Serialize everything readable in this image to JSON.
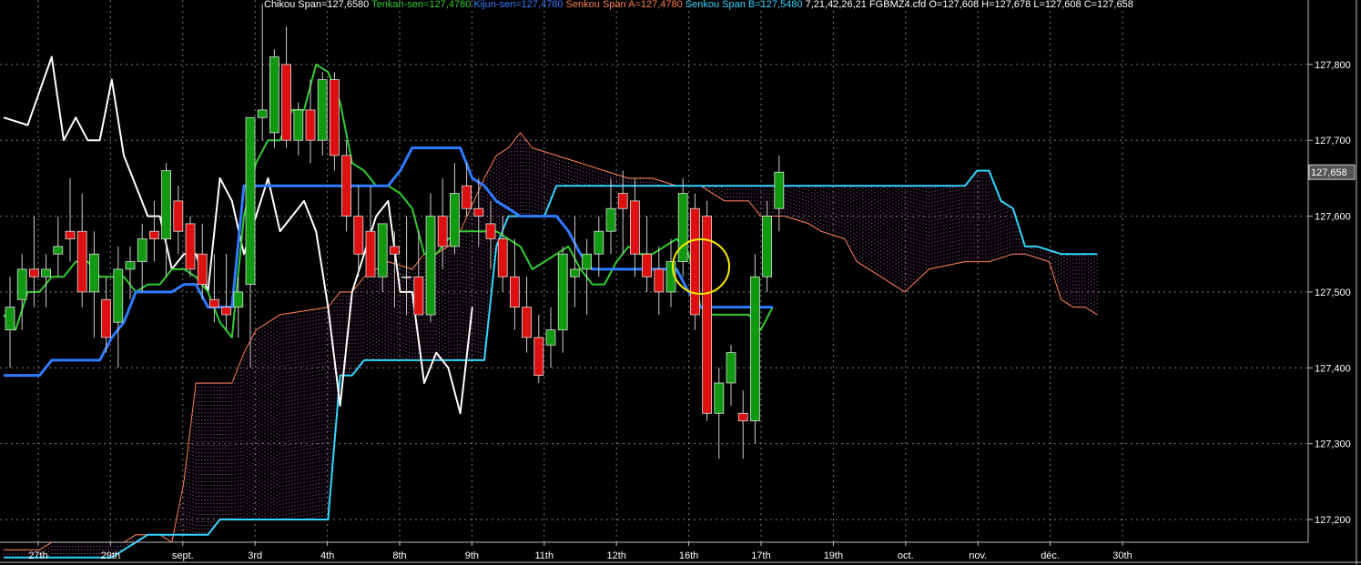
{
  "header": {
    "items": [
      {
        "text": "Chikou Span=127,6580",
        "color": "#ffffff"
      },
      {
        "text": "Tenkan-sen=127,4780",
        "color": "#33cc33"
      },
      {
        "text": "Kijun-sen=127,4780",
        "color": "#3a7bff"
      },
      {
        "text": "Senkou Span A=127,4780",
        "color": "#ff7f50"
      },
      {
        "text": "Senkou Span B=127,5480",
        "color": "#33d6ff"
      },
      {
        "text": "7,21,42,26,21",
        "color": "#ffffff"
      },
      {
        "text": "FGBMZ4.cfd O=127,608 H=127,678 L=127,608 C=127,658",
        "color": "#ffffff"
      }
    ]
  },
  "colors": {
    "background": "#000000",
    "grid": "#7a7a7a",
    "bull": "#119a11",
    "bear": "#dd1111",
    "wick": "#cccccc",
    "chikou": "#ffffff",
    "tenkan": "#33cc33",
    "kijun": "#2f7bff",
    "spanA": "#ff7f50",
    "spanB": "#33d6ff",
    "cloud": "#d36bd3",
    "highlight": "#ffee00"
  },
  "chart_data": {
    "type": "candlestick",
    "ylim": [
      127.17,
      127.885
    ],
    "x_ticks": [
      "27th",
      "29th",
      "sept.",
      "3rd",
      "4th",
      "8th",
      "9th",
      "11th",
      "12th",
      "16th",
      "17th",
      "19th",
      "oct.",
      "nov.",
      "déc.",
      "30th"
    ],
    "y_ticks": [
      "127,200",
      "127,300",
      "127,400",
      "127,500",
      "127,600",
      "127,700",
      "127,800"
    ],
    "y_tick_values": [
      127.2,
      127.3,
      127.4,
      127.5,
      127.6,
      127.7,
      127.8
    ],
    "last_price_label": "127,658",
    "last_price": 127.658,
    "candles": [
      {
        "o": 127.45,
        "h": 127.52,
        "l": 127.4,
        "c": 127.48
      },
      {
        "o": 127.49,
        "h": 127.55,
        "l": 127.45,
        "c": 127.53
      },
      {
        "o": 127.53,
        "h": 127.6,
        "l": 127.48,
        "c": 127.52
      },
      {
        "o": 127.52,
        "h": 127.55,
        "l": 127.48,
        "c": 127.53
      },
      {
        "o": 127.55,
        "h": 127.6,
        "l": 127.52,
        "c": 127.56
      },
      {
        "o": 127.58,
        "h": 127.65,
        "l": 127.54,
        "c": 127.57
      },
      {
        "o": 127.58,
        "h": 127.63,
        "l": 127.48,
        "c": 127.5
      },
      {
        "o": 127.5,
        "h": 127.58,
        "l": 127.44,
        "c": 127.55
      },
      {
        "o": 127.49,
        "h": 127.52,
        "l": 127.42,
        "c": 127.44
      },
      {
        "o": 127.46,
        "h": 127.56,
        "l": 127.4,
        "c": 127.53
      },
      {
        "o": 127.53,
        "h": 127.56,
        "l": 127.49,
        "c": 127.54
      },
      {
        "o": 127.54,
        "h": 127.59,
        "l": 127.5,
        "c": 127.57
      },
      {
        "o": 127.58,
        "h": 127.62,
        "l": 127.54,
        "c": 127.57
      },
      {
        "o": 127.57,
        "h": 127.67,
        "l": 127.52,
        "c": 127.66
      },
      {
        "o": 127.62,
        "h": 127.64,
        "l": 127.55,
        "c": 127.58
      },
      {
        "o": 127.59,
        "h": 127.6,
        "l": 127.52,
        "c": 127.53
      },
      {
        "o": 127.55,
        "h": 127.59,
        "l": 127.49,
        "c": 127.51
      },
      {
        "o": 127.49,
        "h": 127.55,
        "l": 127.46,
        "c": 127.48
      },
      {
        "o": 127.48,
        "h": 127.55,
        "l": 127.45,
        "c": 127.47
      },
      {
        "o": 127.48,
        "h": 127.52,
        "l": 127.44,
        "c": 127.5
      },
      {
        "o": 127.51,
        "h": 127.7,
        "l": 127.4,
        "c": 127.73
      },
      {
        "o": 127.73,
        "h": 127.88,
        "l": 127.7,
        "c": 127.74
      },
      {
        "o": 127.71,
        "h": 127.82,
        "l": 127.69,
        "c": 127.81
      },
      {
        "o": 127.8,
        "h": 127.85,
        "l": 127.69,
        "c": 127.7
      },
      {
        "o": 127.7,
        "h": 127.75,
        "l": 127.68,
        "c": 127.74
      },
      {
        "o": 127.74,
        "h": 127.78,
        "l": 127.67,
        "c": 127.7
      },
      {
        "o": 127.7,
        "h": 127.79,
        "l": 127.68,
        "c": 127.78
      },
      {
        "o": 127.78,
        "h": 127.79,
        "l": 127.66,
        "c": 127.68
      },
      {
        "o": 127.68,
        "h": 127.7,
        "l": 127.58,
        "c": 127.6
      },
      {
        "o": 127.6,
        "h": 127.64,
        "l": 127.52,
        "c": 127.55
      },
      {
        "o": 127.58,
        "h": 127.64,
        "l": 127.52,
        "c": 127.52
      },
      {
        "o": 127.52,
        "h": 127.58,
        "l": 127.5,
        "c": 127.59
      },
      {
        "o": 127.56,
        "h": 127.58,
        "l": 127.48,
        "c": 127.55
      },
      {
        "o": 127.52,
        "h": 127.6,
        "l": 127.47,
        "c": 127.52
      },
      {
        "o": 127.52,
        "h": 127.58,
        "l": 127.47,
        "c": 127.47
      },
      {
        "o": 127.47,
        "h": 127.63,
        "l": 127.46,
        "c": 127.6
      },
      {
        "o": 127.6,
        "h": 127.65,
        "l": 127.53,
        "c": 127.56
      },
      {
        "o": 127.56,
        "h": 127.67,
        "l": 127.55,
        "c": 127.63
      },
      {
        "o": 127.64,
        "h": 127.67,
        "l": 127.6,
        "c": 127.61
      },
      {
        "o": 127.61,
        "h": 127.65,
        "l": 127.56,
        "c": 127.6
      },
      {
        "o": 127.59,
        "h": 127.62,
        "l": 127.53,
        "c": 127.57
      },
      {
        "o": 127.57,
        "h": 127.6,
        "l": 127.5,
        "c": 127.52
      },
      {
        "o": 127.52,
        "h": 127.57,
        "l": 127.45,
        "c": 127.48
      },
      {
        "o": 127.48,
        "h": 127.52,
        "l": 127.42,
        "c": 127.44
      },
      {
        "o": 127.44,
        "h": 127.47,
        "l": 127.38,
        "c": 127.39
      },
      {
        "o": 127.43,
        "h": 127.48,
        "l": 127.4,
        "c": 127.45
      },
      {
        "o": 127.45,
        "h": 127.56,
        "l": 127.42,
        "c": 127.55
      },
      {
        "o": 127.52,
        "h": 127.6,
        "l": 127.48,
        "c": 127.53
      },
      {
        "o": 127.53,
        "h": 127.57,
        "l": 127.47,
        "c": 127.55
      },
      {
        "o": 127.55,
        "h": 127.6,
        "l": 127.52,
        "c": 127.58
      },
      {
        "o": 127.58,
        "h": 127.65,
        "l": 127.55,
        "c": 127.61
      },
      {
        "o": 127.63,
        "h": 127.66,
        "l": 127.55,
        "c": 127.61
      },
      {
        "o": 127.62,
        "h": 127.65,
        "l": 127.52,
        "c": 127.55
      },
      {
        "o": 127.55,
        "h": 127.6,
        "l": 127.5,
        "c": 127.52
      },
      {
        "o": 127.53,
        "h": 127.56,
        "l": 127.47,
        "c": 127.5
      },
      {
        "o": 127.5,
        "h": 127.57,
        "l": 127.48,
        "c": 127.54
      },
      {
        "o": 127.54,
        "h": 127.65,
        "l": 127.52,
        "c": 127.63
      },
      {
        "o": 127.61,
        "h": 127.63,
        "l": 127.45,
        "c": 127.47
      },
      {
        "o": 127.6,
        "h": 127.62,
        "l": 127.33,
        "c": 127.34
      },
      {
        "o": 127.34,
        "h": 127.4,
        "l": 127.28,
        "c": 127.38
      },
      {
        "o": 127.38,
        "h": 127.43,
        "l": 127.35,
        "c": 127.42
      },
      {
        "o": 127.34,
        "h": 127.37,
        "l": 127.28,
        "c": 127.33
      },
      {
        "o": 127.33,
        "h": 127.55,
        "l": 127.3,
        "c": 127.52
      },
      {
        "o": 127.52,
        "h": 127.62,
        "l": 127.5,
        "c": 127.6
      },
      {
        "o": 127.61,
        "h": 127.68,
        "l": 127.58,
        "c": 127.658
      }
    ],
    "series": [
      {
        "name": "Chikou Span",
        "x": [
          0,
          2,
          4,
          5,
          6,
          7,
          8,
          9,
          10,
          12,
          13,
          14,
          15,
          16,
          17,
          18,
          19,
          20,
          21,
          22,
          23,
          24,
          25,
          26,
          27,
          28,
          29,
          30,
          31,
          32,
          33,
          34,
          35,
          36,
          37,
          38,
          39
        ],
        "values": [
          127.73,
          127.72,
          127.81,
          127.7,
          127.73,
          127.7,
          127.7,
          127.78,
          127.68,
          127.6,
          127.6,
          127.53,
          127.55,
          127.55,
          127.5,
          127.65,
          127.62,
          127.55,
          127.6,
          127.65,
          127.58,
          127.6,
          127.62,
          127.58,
          127.48,
          127.35,
          127.5,
          127.55,
          127.6,
          127.62,
          127.5,
          127.5,
          127.38,
          127.42,
          127.4,
          127.34,
          127.48
        ]
      },
      {
        "name": "Tenkan-sen",
        "x": [
          0,
          1,
          2,
          3,
          4,
          5,
          6,
          7,
          8,
          9,
          10,
          11,
          12,
          13,
          14,
          15,
          16,
          17,
          18,
          19,
          20,
          21,
          22,
          23,
          24,
          25,
          26,
          27,
          28,
          29,
          30,
          31,
          32,
          33,
          34,
          35,
          36,
          37,
          38,
          39,
          40,
          41,
          42,
          43,
          44,
          45,
          46,
          47,
          48,
          49,
          50,
          51,
          52,
          53,
          54,
          55,
          56,
          57,
          58,
          59,
          60,
          61,
          62,
          63,
          64
        ],
        "values": [
          127.47,
          127.45,
          127.5,
          127.5,
          127.52,
          127.52,
          127.54,
          127.54,
          127.52,
          127.52,
          127.52,
          127.5,
          127.51,
          127.51,
          127.53,
          127.53,
          127.52,
          127.5,
          127.46,
          127.44,
          127.6,
          127.67,
          127.7,
          127.7,
          127.74,
          127.74,
          127.8,
          127.79,
          127.75,
          127.67,
          127.66,
          127.64,
          127.64,
          127.63,
          127.61,
          127.55,
          127.55,
          127.57,
          127.58,
          127.58,
          127.58,
          127.58,
          127.57,
          127.56,
          127.53,
          127.54,
          127.55,
          127.56,
          127.53,
          127.51,
          127.51,
          127.54,
          127.56,
          127.55,
          127.55,
          127.56,
          127.57,
          127.55,
          127.48,
          127.47,
          127.47,
          127.47,
          127.47,
          127.45,
          127.48
        ]
      },
      {
        "name": "Kijun-sen",
        "x": [
          0,
          1,
          2,
          3,
          4,
          5,
          6,
          7,
          8,
          9,
          10,
          11,
          12,
          13,
          14,
          15,
          16,
          17,
          18,
          19,
          20,
          21,
          22,
          23,
          24,
          25,
          26,
          27,
          28,
          29,
          30,
          31,
          32,
          33,
          34,
          35,
          36,
          37,
          38,
          39,
          40,
          41,
          42,
          43,
          44,
          45,
          46,
          47,
          48,
          49,
          50,
          51,
          52,
          53,
          54,
          55,
          56,
          57,
          58,
          59,
          60,
          61,
          62,
          63,
          64
        ],
        "values": [
          127.39,
          127.39,
          127.39,
          127.39,
          127.41,
          127.41,
          127.41,
          127.41,
          127.41,
          127.44,
          127.46,
          127.5,
          127.5,
          127.5,
          127.5,
          127.51,
          127.51,
          127.48,
          127.48,
          127.48,
          127.64,
          127.64,
          127.64,
          127.64,
          127.64,
          127.64,
          127.64,
          127.64,
          127.64,
          127.64,
          127.64,
          127.64,
          127.64,
          127.66,
          127.69,
          127.69,
          127.69,
          127.69,
          127.69,
          127.65,
          127.64,
          127.62,
          127.61,
          127.6,
          127.6,
          127.6,
          127.6,
          127.58,
          127.55,
          127.53,
          127.53,
          127.53,
          127.53,
          127.53,
          127.53,
          127.53,
          127.53,
          127.5,
          127.48,
          127.48,
          127.48,
          127.48,
          127.48,
          127.48,
          127.48
        ]
      },
      {
        "name": "Senkou Span A",
        "x": [
          0,
          3,
          4,
          10,
          11,
          13,
          14,
          15,
          16,
          19,
          20,
          21,
          22,
          23,
          27,
          28,
          29,
          30,
          32,
          34,
          35,
          36,
          37,
          38,
          40,
          41,
          42,
          43,
          44,
          46,
          48,
          50,
          52,
          54,
          56,
          58,
          60,
          62,
          63,
          65,
          67,
          68,
          70,
          71,
          75,
          77,
          80,
          82,
          84,
          85,
          87,
          88,
          89,
          90,
          91
        ],
        "values": [
          127.16,
          127.16,
          127.17,
          127.17,
          127.18,
          127.18,
          127.17,
          127.25,
          127.38,
          127.38,
          127.42,
          127.45,
          127.46,
          127.47,
          127.48,
          127.5,
          127.5,
          127.52,
          127.54,
          127.53,
          127.55,
          127.55,
          127.56,
          127.58,
          127.65,
          127.68,
          127.69,
          127.71,
          127.69,
          127.68,
          127.67,
          127.66,
          127.65,
          127.65,
          127.64,
          127.64,
          127.62,
          127.62,
          127.6,
          127.6,
          127.59,
          127.58,
          127.57,
          127.54,
          127.5,
          127.53,
          127.54,
          127.54,
          127.55,
          127.55,
          127.54,
          127.49,
          127.48,
          127.48,
          127.47
        ]
      },
      {
        "name": "Senkou Span B",
        "x": [
          0,
          1,
          9,
          10,
          11,
          12,
          15,
          16,
          17,
          18,
          19,
          20,
          21,
          23,
          24,
          27,
          28,
          29,
          30,
          31,
          35,
          36,
          37,
          38,
          40,
          41,
          42,
          43,
          44,
          45,
          46,
          47,
          48,
          49,
          50,
          51,
          52,
          53,
          54,
          55,
          58,
          60,
          63,
          64,
          68,
          69,
          70,
          72,
          74,
          75,
          76,
          80,
          81,
          82,
          83,
          84,
          85,
          86,
          88,
          89,
          90,
          91
        ],
        "values": [
          127.15,
          127.15,
          127.15,
          127.16,
          127.17,
          127.18,
          127.18,
          127.18,
          127.18,
          127.2,
          127.2,
          127.2,
          127.2,
          127.2,
          127.2,
          127.2,
          127.39,
          127.39,
          127.41,
          127.41,
          127.41,
          127.41,
          127.41,
          127.41,
          127.41,
          127.56,
          127.6,
          127.6,
          127.6,
          127.6,
          127.64,
          127.64,
          127.64,
          127.64,
          127.64,
          127.64,
          127.64,
          127.64,
          127.64,
          127.64,
          127.64,
          127.64,
          127.64,
          127.64,
          127.64,
          127.64,
          127.64,
          127.64,
          127.64,
          127.64,
          127.64,
          127.64,
          127.66,
          127.66,
          127.62,
          127.61,
          127.56,
          127.56,
          127.55,
          127.55,
          127.55,
          127.55
        ]
      }
    ]
  }
}
